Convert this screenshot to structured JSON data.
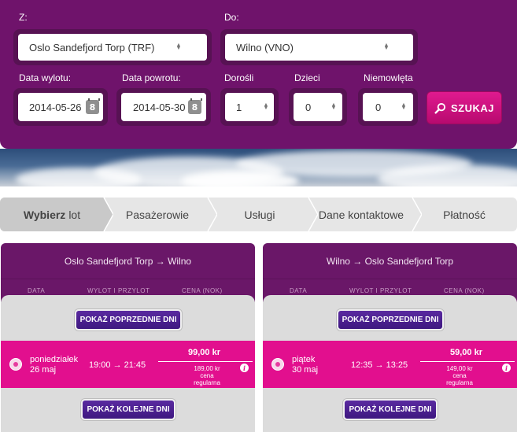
{
  "search": {
    "from_label": "Z:",
    "from_value": "Oslo Sandefjord Torp (TRF)",
    "to_label": "Do:",
    "to_value": "Wilno (VNO)",
    "depart_label": "Data wylotu:",
    "depart_value": "2014-05-26",
    "return_label": "Data powrotu:",
    "return_value": "2014-05-30",
    "calendar_glyph": "8",
    "adults_label": "Dorośli",
    "adults_value": "1",
    "children_label": "Dzieci",
    "children_value": "0",
    "infants_label": "Niemowlęta",
    "infants_value": "0",
    "search_button": "SZUKAJ"
  },
  "steps": {
    "step1_bold": "Wybierz",
    "step1_rest": "lot",
    "step2": "Pasażerowie",
    "step3": "Usługi",
    "step4": "Dane kontaktowe",
    "step5": "Płatność"
  },
  "outbound": {
    "route": "Oslo Sandefjord Torp → Wilno",
    "col_date": "DATA",
    "col_times": "WYLOT I PRZYLOT",
    "col_price": "CENA (NOK)",
    "prev_button": "POKAŻ POPRZEDNIE DNI",
    "next_button": "POKAŻ KOLEJNE DNI",
    "flight": {
      "weekday": "poniedziałek",
      "date": "26 maj",
      "times": "19:00 → 21:45",
      "price": "99,00 kr",
      "regular_price": "189,00 kr",
      "regular_label": "cena regularna"
    }
  },
  "return": {
    "route": "Wilno → Oslo Sandefjord Torp",
    "col_date": "DATA",
    "col_times": "WYLOT I PRZYLOT",
    "col_price": "CENA (NOK)",
    "prev_button": "POKAŻ POPRZEDNIE DNI",
    "next_button": "POKAŻ KOLEJNE DNI",
    "flight": {
      "weekday": "piątek",
      "date": "30 maj",
      "times": "12:35 → 13:25",
      "price": "59,00 kr",
      "regular_price": "149,00 kr",
      "regular_label": "cena regularna"
    }
  },
  "icons": {
    "select_arrows": "updown-arrows-icon",
    "calendar": "calendar-icon",
    "search": "magnifier-icon",
    "info": "info-icon",
    "radio": "radio-icon"
  },
  "colors": {
    "brand_purple": "#6f136b",
    "accent_pink": "#e20f8e",
    "button_purple": "#4a1e8e"
  }
}
